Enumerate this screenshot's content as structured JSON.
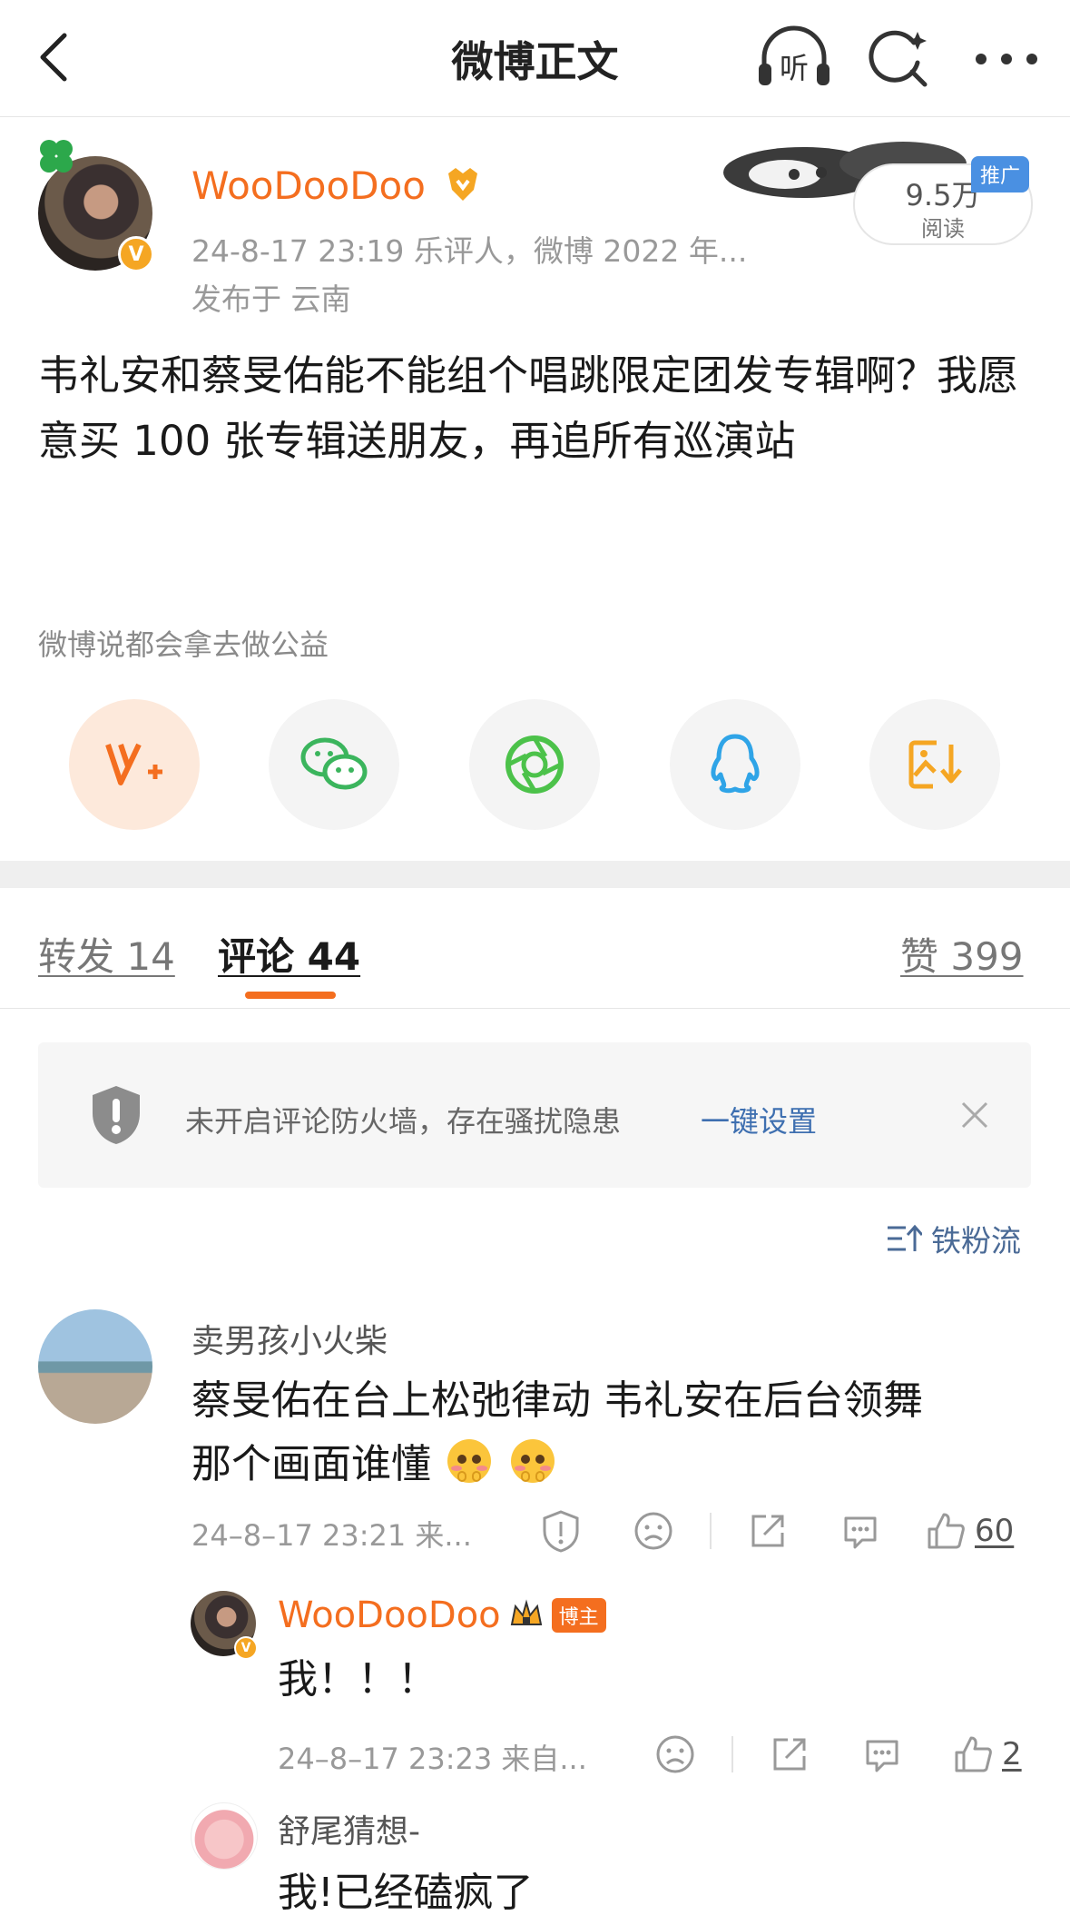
{
  "nav": {
    "title": "微博正文",
    "back_icon": "back-arrow-icon",
    "listen_icon": "headphone-icon",
    "listen_label": "听",
    "search_icon": "search-icon",
    "more_icon": "more-icon"
  },
  "post": {
    "author": "WooDooDoo",
    "meta": "24-8-17 23:19  乐评人，微博 2022 年...",
    "location": "发布于 云南",
    "read_count": "9.5万",
    "read_label": "阅读",
    "promo": "推广",
    "text": "韦礼安和蔡旻佑能不能组个唱跳限定团发专辑啊？我愿意买 100 张专辑送朋友，再追所有巡演站",
    "note": "微博说都会拿去做公益",
    "verified_mark": "V"
  },
  "share": [
    {
      "name": "share-weibo-vplus",
      "icon": "vplus-icon",
      "color": "#f46e1f"
    },
    {
      "name": "share-wechat",
      "icon": "wechat-icon",
      "color": "#3bb55d"
    },
    {
      "name": "share-moments",
      "icon": "moments-icon",
      "color": "#4cc24a"
    },
    {
      "name": "share-qq",
      "icon": "qq-icon",
      "color": "#2fa4e7"
    },
    {
      "name": "share-save-image",
      "icon": "save-image-icon",
      "color": "#f5a623"
    }
  ],
  "tabs": {
    "repost": "转发 14",
    "comment": "评论 44",
    "like": "赞 399"
  },
  "notice": {
    "text": "未开启评论防火墙，存在骚扰隐患",
    "link": "一键设置"
  },
  "sort_label": "铁粉流",
  "comments": [
    {
      "name": "卖男孩小火柴",
      "line1": "蔡旻佑在台上松弛律动  韦礼安在后台领舞",
      "line2": "那个画面谁懂",
      "time": "24–8–17 23:21  来...",
      "likes": "60"
    }
  ],
  "replies": [
    {
      "name": "WooDooDoo",
      "tag": "博主",
      "text": "我！！！",
      "time": "24–8–17 23:23  来自...",
      "likes": "2"
    },
    {
      "name": "舒尾猜想-",
      "text": "我!已经磕疯了"
    }
  ],
  "colors": {
    "accent": "#f46e1f",
    "link": "#3e6fb0",
    "meta": "#999999"
  }
}
